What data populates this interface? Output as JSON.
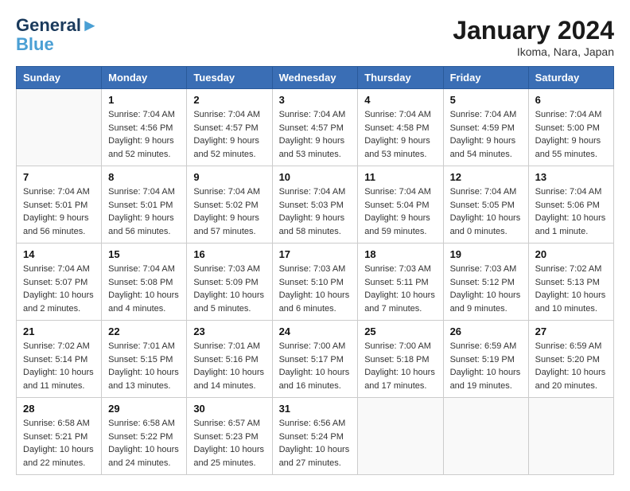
{
  "header": {
    "logo_line1": "General",
    "logo_line2": "Blue",
    "month_title": "January 2024",
    "location": "Ikoma, Nara, Japan"
  },
  "weekdays": [
    "Sunday",
    "Monday",
    "Tuesday",
    "Wednesday",
    "Thursday",
    "Friday",
    "Saturday"
  ],
  "weeks": [
    [
      {
        "day": "",
        "sunrise": "",
        "sunset": "",
        "daylight": ""
      },
      {
        "day": "1",
        "sunrise": "Sunrise: 7:04 AM",
        "sunset": "Sunset: 4:56 PM",
        "daylight": "Daylight: 9 hours and 52 minutes."
      },
      {
        "day": "2",
        "sunrise": "Sunrise: 7:04 AM",
        "sunset": "Sunset: 4:57 PM",
        "daylight": "Daylight: 9 hours and 52 minutes."
      },
      {
        "day": "3",
        "sunrise": "Sunrise: 7:04 AM",
        "sunset": "Sunset: 4:57 PM",
        "daylight": "Daylight: 9 hours and 53 minutes."
      },
      {
        "day": "4",
        "sunrise": "Sunrise: 7:04 AM",
        "sunset": "Sunset: 4:58 PM",
        "daylight": "Daylight: 9 hours and 53 minutes."
      },
      {
        "day": "5",
        "sunrise": "Sunrise: 7:04 AM",
        "sunset": "Sunset: 4:59 PM",
        "daylight": "Daylight: 9 hours and 54 minutes."
      },
      {
        "day": "6",
        "sunrise": "Sunrise: 7:04 AM",
        "sunset": "Sunset: 5:00 PM",
        "daylight": "Daylight: 9 hours and 55 minutes."
      }
    ],
    [
      {
        "day": "7",
        "sunrise": "Sunrise: 7:04 AM",
        "sunset": "Sunset: 5:01 PM",
        "daylight": "Daylight: 9 hours and 56 minutes."
      },
      {
        "day": "8",
        "sunrise": "Sunrise: 7:04 AM",
        "sunset": "Sunset: 5:01 PM",
        "daylight": "Daylight: 9 hours and 56 minutes."
      },
      {
        "day": "9",
        "sunrise": "Sunrise: 7:04 AM",
        "sunset": "Sunset: 5:02 PM",
        "daylight": "Daylight: 9 hours and 57 minutes."
      },
      {
        "day": "10",
        "sunrise": "Sunrise: 7:04 AM",
        "sunset": "Sunset: 5:03 PM",
        "daylight": "Daylight: 9 hours and 58 minutes."
      },
      {
        "day": "11",
        "sunrise": "Sunrise: 7:04 AM",
        "sunset": "Sunset: 5:04 PM",
        "daylight": "Daylight: 9 hours and 59 minutes."
      },
      {
        "day": "12",
        "sunrise": "Sunrise: 7:04 AM",
        "sunset": "Sunset: 5:05 PM",
        "daylight": "Daylight: 10 hours and 0 minutes."
      },
      {
        "day": "13",
        "sunrise": "Sunrise: 7:04 AM",
        "sunset": "Sunset: 5:06 PM",
        "daylight": "Daylight: 10 hours and 1 minute."
      }
    ],
    [
      {
        "day": "14",
        "sunrise": "Sunrise: 7:04 AM",
        "sunset": "Sunset: 5:07 PM",
        "daylight": "Daylight: 10 hours and 2 minutes."
      },
      {
        "day": "15",
        "sunrise": "Sunrise: 7:04 AM",
        "sunset": "Sunset: 5:08 PM",
        "daylight": "Daylight: 10 hours and 4 minutes."
      },
      {
        "day": "16",
        "sunrise": "Sunrise: 7:03 AM",
        "sunset": "Sunset: 5:09 PM",
        "daylight": "Daylight: 10 hours and 5 minutes."
      },
      {
        "day": "17",
        "sunrise": "Sunrise: 7:03 AM",
        "sunset": "Sunset: 5:10 PM",
        "daylight": "Daylight: 10 hours and 6 minutes."
      },
      {
        "day": "18",
        "sunrise": "Sunrise: 7:03 AM",
        "sunset": "Sunset: 5:11 PM",
        "daylight": "Daylight: 10 hours and 7 minutes."
      },
      {
        "day": "19",
        "sunrise": "Sunrise: 7:03 AM",
        "sunset": "Sunset: 5:12 PM",
        "daylight": "Daylight: 10 hours and 9 minutes."
      },
      {
        "day": "20",
        "sunrise": "Sunrise: 7:02 AM",
        "sunset": "Sunset: 5:13 PM",
        "daylight": "Daylight: 10 hours and 10 minutes."
      }
    ],
    [
      {
        "day": "21",
        "sunrise": "Sunrise: 7:02 AM",
        "sunset": "Sunset: 5:14 PM",
        "daylight": "Daylight: 10 hours and 11 minutes."
      },
      {
        "day": "22",
        "sunrise": "Sunrise: 7:01 AM",
        "sunset": "Sunset: 5:15 PM",
        "daylight": "Daylight: 10 hours and 13 minutes."
      },
      {
        "day": "23",
        "sunrise": "Sunrise: 7:01 AM",
        "sunset": "Sunset: 5:16 PM",
        "daylight": "Daylight: 10 hours and 14 minutes."
      },
      {
        "day": "24",
        "sunrise": "Sunrise: 7:00 AM",
        "sunset": "Sunset: 5:17 PM",
        "daylight": "Daylight: 10 hours and 16 minutes."
      },
      {
        "day": "25",
        "sunrise": "Sunrise: 7:00 AM",
        "sunset": "Sunset: 5:18 PM",
        "daylight": "Daylight: 10 hours and 17 minutes."
      },
      {
        "day": "26",
        "sunrise": "Sunrise: 6:59 AM",
        "sunset": "Sunset: 5:19 PM",
        "daylight": "Daylight: 10 hours and 19 minutes."
      },
      {
        "day": "27",
        "sunrise": "Sunrise: 6:59 AM",
        "sunset": "Sunset: 5:20 PM",
        "daylight": "Daylight: 10 hours and 20 minutes."
      }
    ],
    [
      {
        "day": "28",
        "sunrise": "Sunrise: 6:58 AM",
        "sunset": "Sunset: 5:21 PM",
        "daylight": "Daylight: 10 hours and 22 minutes."
      },
      {
        "day": "29",
        "sunrise": "Sunrise: 6:58 AM",
        "sunset": "Sunset: 5:22 PM",
        "daylight": "Daylight: 10 hours and 24 minutes."
      },
      {
        "day": "30",
        "sunrise": "Sunrise: 6:57 AM",
        "sunset": "Sunset: 5:23 PM",
        "daylight": "Daylight: 10 hours and 25 minutes."
      },
      {
        "day": "31",
        "sunrise": "Sunrise: 6:56 AM",
        "sunset": "Sunset: 5:24 PM",
        "daylight": "Daylight: 10 hours and 27 minutes."
      },
      {
        "day": "",
        "sunrise": "",
        "sunset": "",
        "daylight": ""
      },
      {
        "day": "",
        "sunrise": "",
        "sunset": "",
        "daylight": ""
      },
      {
        "day": "",
        "sunrise": "",
        "sunset": "",
        "daylight": ""
      }
    ]
  ]
}
